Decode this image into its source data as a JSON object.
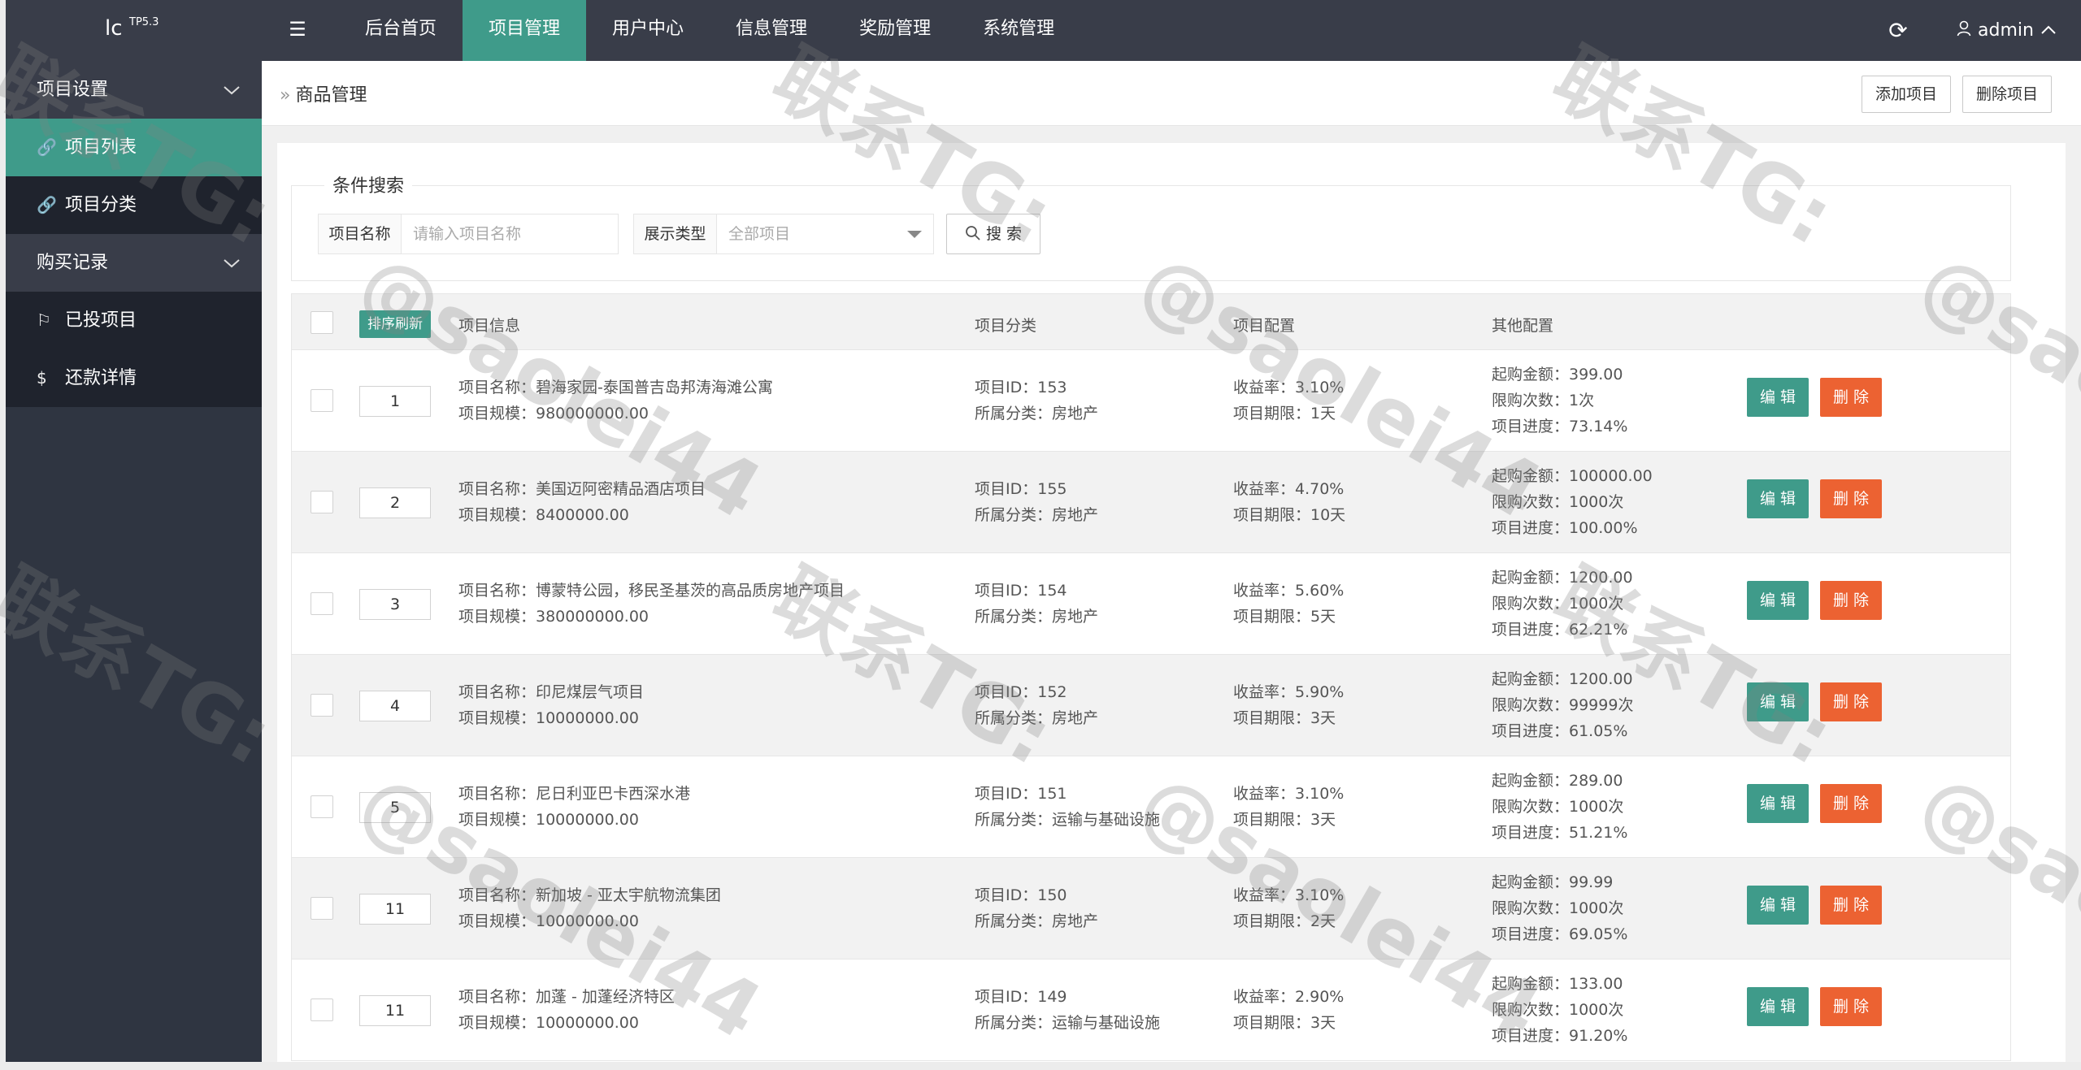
{
  "logo": {
    "text": "lc",
    "version": "TP5.3"
  },
  "header": {
    "menu_icon": "menu-icon",
    "nav": [
      "后台首页",
      "项目管理",
      "用户中心",
      "信息管理",
      "奖励管理",
      "系统管理"
    ],
    "active_nav": "项目管理",
    "refresh_icon": "refresh-icon",
    "user": "admin"
  },
  "sidebar": {
    "group1": "项目设置",
    "item_list": "项目列表",
    "item_category": "项目分类",
    "group2": "购买记录",
    "item_invested": "已投项目",
    "item_repay": "还款详情"
  },
  "topbar": {
    "breadcrumb": "商品管理",
    "add_label": "添加项目",
    "delete_label": "删除项目"
  },
  "search": {
    "legend": "条件搜索",
    "name_label": "项目名称",
    "name_placeholder": "请输入项目名称",
    "type_label": "展示类型",
    "type_value": "全部项目",
    "button": "搜 索"
  },
  "table": {
    "sort_button": "排序刷新",
    "headers": [
      "项目信息",
      "项目分类",
      "项目配置",
      "其他配置"
    ],
    "edit_label": "编 辑",
    "delete_label": "删 除",
    "rows": [
      {
        "sort": "1",
        "name": "项目名称：碧海家园-泰国普吉岛邦涛海滩公寓",
        "scale": "项目规模：980000000.00",
        "id": "项目ID：153",
        "cat": "所属分类：房地产",
        "rate": "收益率：3.10%",
        "term": "项目期限：1天",
        "min": "起购金额：399.00",
        "limit": "限购次数：1次",
        "progress": "项目进度：73.14%"
      },
      {
        "sort": "2",
        "name": "项目名称：美国迈阿密精品酒店项目",
        "scale": "项目规模：8400000.00",
        "id": "项目ID：155",
        "cat": "所属分类：房地产",
        "rate": "收益率：4.70%",
        "term": "项目期限：10天",
        "min": "起购金额：100000.00",
        "limit": "限购次数：1000次",
        "progress": "项目进度：100.00%"
      },
      {
        "sort": "3",
        "name": "项目名称：博蒙特公园，移民圣基茨的高品质房地产项目",
        "scale": "项目规模：380000000.00",
        "id": "项目ID：154",
        "cat": "所属分类：房地产",
        "rate": "收益率：5.60%",
        "term": "项目期限：5天",
        "min": "起购金额：1200.00",
        "limit": "限购次数：1000次",
        "progress": "项目进度：62.21%"
      },
      {
        "sort": "4",
        "name": "项目名称：印尼煤层气项目",
        "scale": "项目规模：10000000.00",
        "id": "项目ID：152",
        "cat": "所属分类：房地产",
        "rate": "收益率：5.90%",
        "term": "项目期限：3天",
        "min": "起购金额：1200.00",
        "limit": "限购次数：99999次",
        "progress": "项目进度：61.05%"
      },
      {
        "sort": "5",
        "name": "项目名称：尼日利亚巴卡西深水港",
        "scale": "项目规模：10000000.00",
        "id": "项目ID：151",
        "cat": "所属分类：运输与基础设施",
        "rate": "收益率：3.10%",
        "term": "项目期限：3天",
        "min": "起购金额：289.00",
        "limit": "限购次数：1000次",
        "progress": "项目进度：51.21%"
      },
      {
        "sort": "11",
        "name": "项目名称：新加坡 - 亚太宇航物流集团",
        "scale": "项目规模：10000000.00",
        "id": "项目ID：150",
        "cat": "所属分类：房地产",
        "rate": "收益率：3.10%",
        "term": "项目期限：2天",
        "min": "起购金额：99.99",
        "limit": "限购次数：1000次",
        "progress": "项目进度：69.05%"
      },
      {
        "sort": "11",
        "name": "项目名称：加蓬 - 加蓬经济特区",
        "scale": "项目规模：10000000.00",
        "id": "项目ID：149",
        "cat": "所属分类：运输与基础设施",
        "rate": "收益率：2.90%",
        "term": "项目期限：3天",
        "min": "起购金额：133.00",
        "limit": "限购次数：1000次",
        "progress": "项目进度：91.20%"
      }
    ]
  },
  "watermark": {
    "line1": "联系TG:",
    "line2": "@saolei44"
  }
}
